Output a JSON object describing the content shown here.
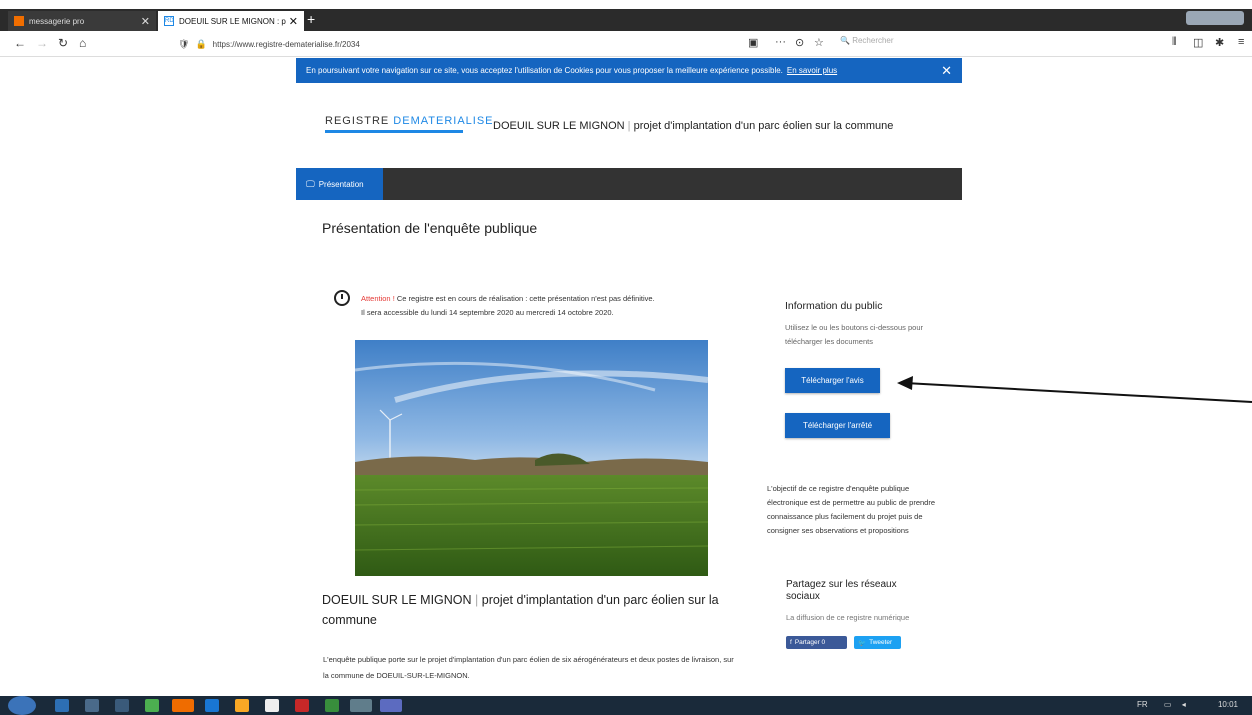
{
  "browser": {
    "tab1_title": "messagerie pro",
    "tab2_title": "DOEUIL SUR LE MIGNON : p",
    "tab2_favicon": "RD",
    "url": "https://www.registre-dematerialise.fr/2034",
    "search_placeholder": "Rechercher"
  },
  "cookie": {
    "text": "En poursuivant votre navigation sur ce site, vous acceptez l'utilisation de Cookies pour vous proposer la meilleure expérience possible.",
    "more": "En savoir plus"
  },
  "site": {
    "logo_part1": "REGISTRE ",
    "logo_part2": "DEMATERIALISE",
    "title_main": "DOEUIL SUR LE MIGNON",
    "title_sep": " | ",
    "title_rest": "projet d'implantation d'un parc éolien sur la commune"
  },
  "menu": {
    "presentation": "Présentation"
  },
  "page": {
    "title": "Présentation de l'enquête publique",
    "notice_warn": "Attention !",
    "notice_text": " Ce registre est en cours de réalisation : cette présentation n'est pas définitive.",
    "notice_text2": "Il sera accessible du lundi 14 septembre 2020 au mercredi 14 octobre 2020.",
    "project_title_main": "DOEUIL SUR LE MIGNON",
    "project_title_sep": " | ",
    "project_title_rest": "projet d'implantation d'un parc éolien sur la commune",
    "project_desc": "L'enquête publique porte sur le projet d'implantation d'un parc éolien de six aérogénérateurs et deux postes de livraison, sur la commune de DOEUIL-SUR-LE-MIGNON."
  },
  "sidebar": {
    "info_title": "Information du public",
    "info_text": "Utilisez le ou les boutons ci-dessous pour télécharger les documents",
    "btn_avis": "Télécharger l'avis",
    "btn_arrete": "Télécharger l'arrêté",
    "objective": "L'objectif de ce registre d'enquête publique électronique est de permettre au public de prendre connaissance plus facilement du projet puis de consigner ses observations et propositions",
    "share_title": "Partagez sur les réseaux sociaux",
    "share_text": "La diffusion de ce registre numérique",
    "share_fb": "Partager 0",
    "share_tw": "Tweeter"
  },
  "taskbar": {
    "lang": "FR",
    "time": "10:01"
  },
  "colors": {
    "accent": "#1565c0",
    "warning": "#e53935"
  }
}
